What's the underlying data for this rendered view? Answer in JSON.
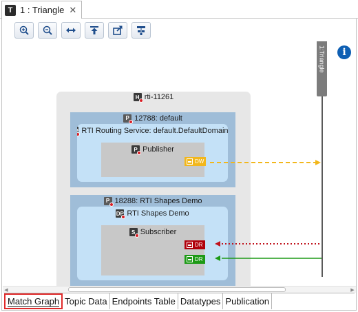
{
  "tab": {
    "badge": "T",
    "title": "1 : Triangle",
    "close": "✕"
  },
  "toolbar": {
    "buttons": [
      {
        "name": "zoom-in-button",
        "icon": "zoom-in-icon"
      },
      {
        "name": "zoom-out-button",
        "icon": "zoom-out-icon"
      },
      {
        "name": "fit-width-button",
        "icon": "fit-width-icon"
      },
      {
        "name": "move-top-button",
        "icon": "move-top-icon"
      },
      {
        "name": "export-button",
        "icon": "export-icon"
      },
      {
        "name": "layout-button",
        "icon": "layout-icon"
      }
    ]
  },
  "info": {
    "glyph": "i",
    "icon": "info-icon"
  },
  "topic": {
    "label": "1:Triangle",
    "color": "#7c7c7c"
  },
  "host": {
    "title": "rti-11261"
  },
  "processes": [
    {
      "title": "12788: default",
      "participant": "RTI Routing Service: default.DefaultDomain...",
      "entity": "Publisher",
      "endpoint": {
        "label": "DW",
        "color": "#f2b71c"
      }
    },
    {
      "title": "18288: RTI Shapes Demo",
      "participant": "RTI Shapes Demo",
      "entity": "Subscriber",
      "endpoints": [
        {
          "label": "DR",
          "color": "#b0000b"
        },
        {
          "label": "DR",
          "color": "#1d9a16"
        }
      ]
    }
  ],
  "icons": {
    "host": "H",
    "process": "P",
    "participant": "DP",
    "publisher": "P",
    "subscriber": "S"
  },
  "links": {
    "dw_color": "#f2b71c",
    "dr_red_color": "#c0111b",
    "dr_green_color": "#1d9a16"
  },
  "view_tabs": [
    {
      "label": "Match Graph",
      "active": true
    },
    {
      "label": "Topic Data",
      "active": false
    },
    {
      "label": "Endpoints Table",
      "active": false
    },
    {
      "label": "Datatypes",
      "active": false
    },
    {
      "label": "Publication",
      "active": false
    }
  ]
}
